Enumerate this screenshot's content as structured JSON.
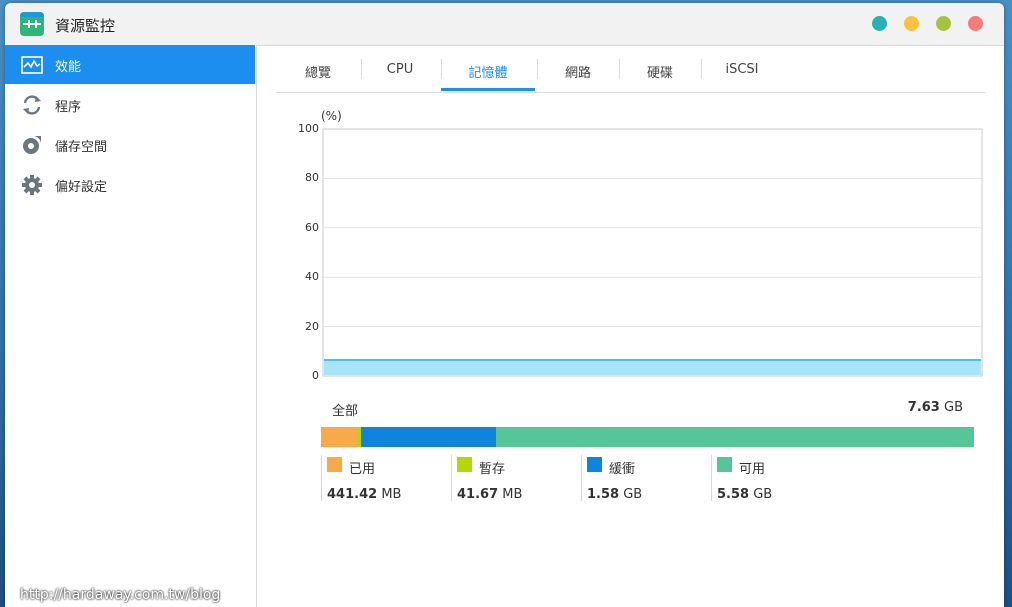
{
  "window": {
    "title": "資源監控"
  },
  "window_buttons": [
    {
      "name": "window-button-1",
      "color": "#26b1b7"
    },
    {
      "name": "window-button-2",
      "color": "#f8c141"
    },
    {
      "name": "window-button-3",
      "color": "#a5c43d"
    },
    {
      "name": "window-button-4",
      "color": "#f57a79"
    }
  ],
  "sidebar": {
    "items": [
      {
        "label": "效能",
        "icon": "performance-chart-icon",
        "active": true
      },
      {
        "label": "程序",
        "icon": "process-refresh-icon",
        "active": false
      },
      {
        "label": "儲存空間",
        "icon": "storage-pie-icon",
        "active": false
      },
      {
        "label": "偏好設定",
        "icon": "gear-icon",
        "active": false
      }
    ]
  },
  "tabs": [
    {
      "label": "總覽",
      "active": false
    },
    {
      "label": "CPU",
      "active": false
    },
    {
      "label": "記憶體",
      "active": true
    },
    {
      "label": "網路",
      "active": false
    },
    {
      "label": "硬碟",
      "active": false
    },
    {
      "label": "iSCSI",
      "active": false
    }
  ],
  "chart_data": {
    "type": "area",
    "ylabel": "(%)",
    "ylim": [
      0,
      100
    ],
    "yticks": [
      "100",
      "80",
      "60",
      "40",
      "20",
      "0"
    ],
    "grid": true,
    "series": [
      {
        "values": [
          6.5,
          6.5,
          6.5,
          6.5,
          6.5,
          6.5,
          6.5,
          6.5,
          6.5,
          6.5,
          6.5
        ],
        "color": "#a8e4f8"
      }
    ]
  },
  "memory": {
    "total_label": "全部",
    "total_value": "7.63",
    "total_unit": "GB",
    "segments": [
      {
        "label": "已用",
        "value": "441.42",
        "unit": "MB",
        "mb": 441.42,
        "color": "#f8a94a"
      },
      {
        "label": "暫存",
        "value": "41.67",
        "unit": "MB",
        "mb": 41.67,
        "color": "#b6d800"
      },
      {
        "label": "緩衝",
        "value": "1.58",
        "unit": "GB",
        "mb": 1617.9,
        "color": "#0f84dd"
      },
      {
        "label": "可用",
        "value": "5.58",
        "unit": "GB",
        "mb": 5713.9,
        "color": "#56c698"
      }
    ]
  },
  "watermark": "http://hardaway.com.tw/blog"
}
